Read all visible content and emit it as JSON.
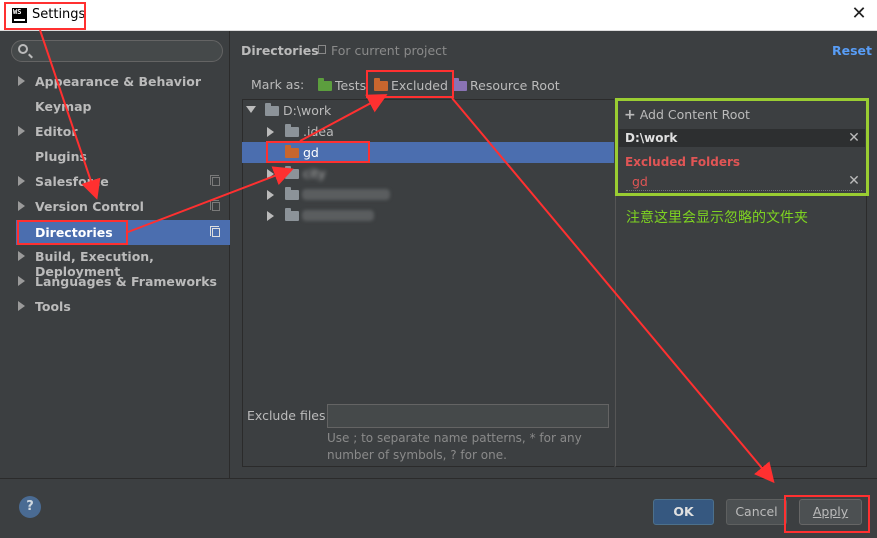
{
  "window": {
    "title": "Settings",
    "logo_text": "WS"
  },
  "sidebar": {
    "search_placeholder": "",
    "items": [
      {
        "label": "Appearance & Behavior",
        "expandable": true
      },
      {
        "label": "Keymap",
        "expandable": false
      },
      {
        "label": "Editor",
        "expandable": true
      },
      {
        "label": "Plugins",
        "expandable": false
      },
      {
        "label": "Salesforce",
        "expandable": true
      },
      {
        "label": "Version Control",
        "expandable": true
      },
      {
        "label": "Directories",
        "expandable": false,
        "selected": true
      },
      {
        "label": "Build, Execution, Deployment",
        "expandable": true
      },
      {
        "label": "Languages & Frameworks",
        "expandable": true
      },
      {
        "label": "Tools",
        "expandable": true
      }
    ]
  },
  "header": {
    "title": "Directories",
    "subtitle": "For current project",
    "reset": "Reset"
  },
  "mark_as": {
    "label": "Mark as:",
    "tests": "Tests",
    "excluded": "Excluded",
    "resource_root": "Resource Root"
  },
  "tree": {
    "root": "D:\\work",
    "children": [
      ".idea",
      "gd",
      "city"
    ]
  },
  "exclude_files": {
    "label": "Exclude files:",
    "value": "",
    "help": "Use ; to separate name patterns, * for any number of symbols, ? for one."
  },
  "content_root": {
    "add_label": "Add Content Root",
    "root_name": "D:\\work",
    "excluded_title": "Excluded Folders",
    "excluded_items": [
      "gd"
    ]
  },
  "annotation_note": "注意这里会显示忽略的文件夹",
  "footer": {
    "help": "?",
    "ok": "OK",
    "cancel": "Cancel",
    "apply": "Apply"
  },
  "colors": {
    "accent_blue": "#4b6eaf",
    "annotation_red": "#ff3030",
    "annotation_green": "#9acd32",
    "excluded_red": "#e05555",
    "folder_tests": "#5c9e3e",
    "folder_excluded": "#c8662e",
    "folder_resource": "#8a73b5"
  }
}
